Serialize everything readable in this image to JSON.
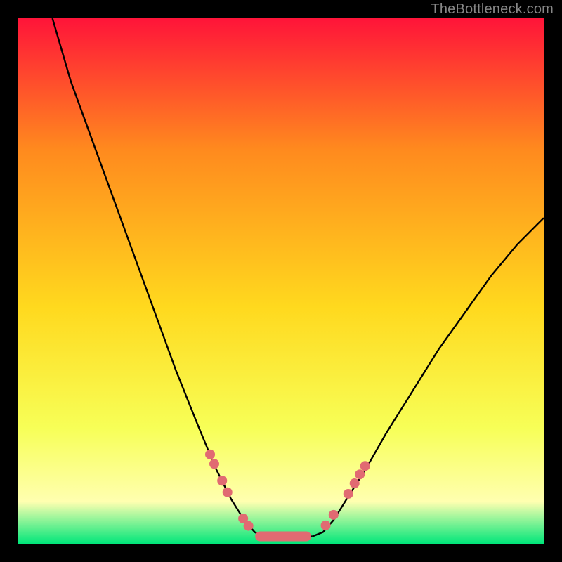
{
  "watermark": "TheBottleneck.com",
  "colors": {
    "grad_top": "#ff1439",
    "grad_q1": "#ff8a1e",
    "grad_mid": "#ffd91e",
    "grad_q3": "#f7ff57",
    "grad_low": "#ffffb0",
    "grad_bottom": "#00e67a",
    "curve": "#000000",
    "marker_fill": "#e16a72",
    "marker_stroke": "#c9575f"
  },
  "chart_data": {
    "type": "line",
    "title": "",
    "xlabel": "",
    "ylabel": "",
    "xlim": [
      0,
      1
    ],
    "ylim": [
      0,
      1
    ],
    "left_curve": {
      "comment": "bottleneck curve descending from upper-left to a flat trough near x≈0.47",
      "x": [
        0.065,
        0.1,
        0.14,
        0.18,
        0.22,
        0.26,
        0.3,
        0.34,
        0.375,
        0.405,
        0.43,
        0.45,
        0.465
      ],
      "y": [
        1.0,
        0.88,
        0.77,
        0.66,
        0.55,
        0.44,
        0.33,
        0.23,
        0.145,
        0.085,
        0.045,
        0.022,
        0.014
      ]
    },
    "trough": {
      "x": [
        0.465,
        0.56
      ],
      "y": 0.014
    },
    "right_curve": {
      "comment": "curve rising from trough toward upper-right, exiting around y≈0.62",
      "x": [
        0.56,
        0.58,
        0.6,
        0.625,
        0.66,
        0.7,
        0.75,
        0.8,
        0.85,
        0.9,
        0.95,
        1.0
      ],
      "y": [
        0.014,
        0.022,
        0.045,
        0.085,
        0.14,
        0.21,
        0.29,
        0.37,
        0.44,
        0.51,
        0.57,
        0.62
      ]
    },
    "markers_left": {
      "x": [
        0.365,
        0.373,
        0.388,
        0.398,
        0.428,
        0.438
      ],
      "y": [
        0.17,
        0.152,
        0.12,
        0.098,
        0.048,
        0.034
      ]
    },
    "markers_right": {
      "x": [
        0.585,
        0.6,
        0.628,
        0.64,
        0.65,
        0.66
      ],
      "y": [
        0.035,
        0.055,
        0.095,
        0.115,
        0.132,
        0.148
      ]
    },
    "markers_trough": {
      "x": [
        0.46,
        0.478,
        0.495,
        0.512,
        0.53,
        0.548
      ],
      "y": 0.014
    }
  }
}
